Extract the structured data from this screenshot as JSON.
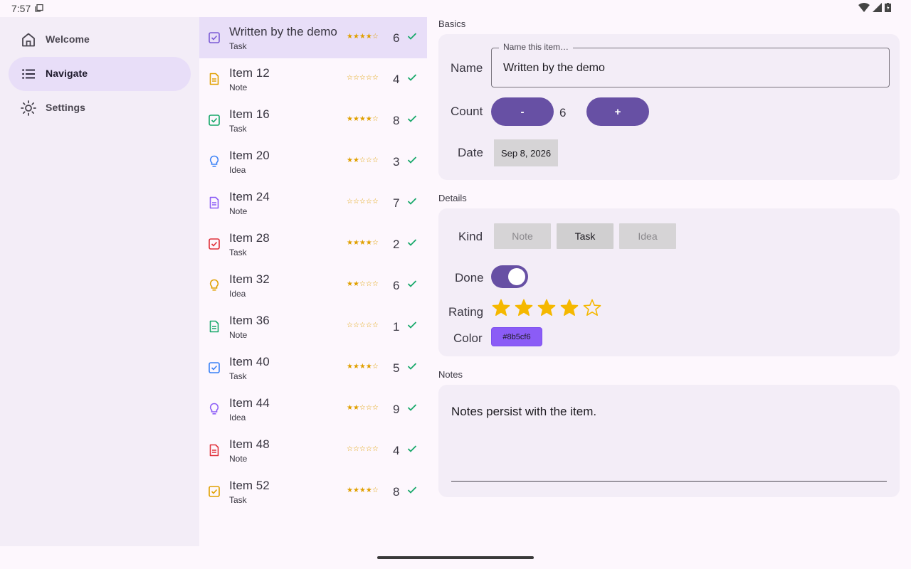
{
  "status_bar": {
    "time": "7:57"
  },
  "drawer": {
    "items": [
      {
        "label": "Welcome",
        "icon": "home-icon",
        "active": false
      },
      {
        "label": "Navigate",
        "icon": "list-icon",
        "active": true
      },
      {
        "label": "Settings",
        "icon": "brightness-icon",
        "active": false
      }
    ]
  },
  "list": {
    "rows": [
      {
        "title": "Written by the demo",
        "kind": "Task",
        "stars": "★★★★☆",
        "count": "6",
        "icon": "task-check-icon",
        "icon_color": "#7c5cd6",
        "selected": true
      },
      {
        "title": "Item 12",
        "kind": "Note",
        "stars": "☆☆☆☆☆",
        "count": "4",
        "icon": "note-doc-icon",
        "icon_color": "#e0a000",
        "selected": false
      },
      {
        "title": "Item 16",
        "kind": "Task",
        "stars": "★★★★☆",
        "count": "8",
        "icon": "task-check-icon",
        "icon_color": "#17a86a",
        "selected": false
      },
      {
        "title": "Item 20",
        "kind": "Idea",
        "stars": "★★☆☆☆",
        "count": "3",
        "icon": "lightbulb-icon",
        "icon_color": "#3b82f6",
        "selected": false
      },
      {
        "title": "Item 24",
        "kind": "Note",
        "stars": "☆☆☆☆☆",
        "count": "7",
        "icon": "note-doc-icon",
        "icon_color": "#8b5cf6",
        "selected": false
      },
      {
        "title": "Item 28",
        "kind": "Task",
        "stars": "★★★★☆",
        "count": "2",
        "icon": "task-check-icon",
        "icon_color": "#e0303a",
        "selected": false
      },
      {
        "title": "Item 32",
        "kind": "Idea",
        "stars": "★★☆☆☆",
        "count": "6",
        "icon": "lightbulb-icon",
        "icon_color": "#e0a000",
        "selected": false
      },
      {
        "title": "Item 36",
        "kind": "Note",
        "stars": "☆☆☆☆☆",
        "count": "1",
        "icon": "note-doc-icon",
        "icon_color": "#17a86a",
        "selected": false
      },
      {
        "title": "Item 40",
        "kind": "Task",
        "stars": "★★★★☆",
        "count": "5",
        "icon": "task-check-icon",
        "icon_color": "#3b82f6",
        "selected": false
      },
      {
        "title": "Item 44",
        "kind": "Idea",
        "stars": "★★☆☆☆",
        "count": "9",
        "icon": "lightbulb-icon",
        "icon_color": "#8b5cf6",
        "selected": false
      },
      {
        "title": "Item 48",
        "kind": "Note",
        "stars": "☆☆☆☆☆",
        "count": "4",
        "icon": "note-doc-icon",
        "icon_color": "#e0303a",
        "selected": false
      },
      {
        "title": "Item 52",
        "kind": "Task",
        "stars": "★★★★☆",
        "count": "8",
        "icon": "task-check-icon",
        "icon_color": "#e0a000",
        "selected": false
      }
    ],
    "check_color": "#17a86a"
  },
  "detail": {
    "basics": {
      "section_label": "Basics",
      "name_label": "Name",
      "name_legend": "Name this item…",
      "name_value": "Written by the demo",
      "count_label": "Count",
      "minus_label": "-",
      "plus_label": "+",
      "count_value": "6",
      "date_label": "Date",
      "date_value": "Sep 8, 2026"
    },
    "details": {
      "section_label": "Details",
      "kind_label": "Kind",
      "kinds": [
        "Note",
        "Task",
        "Idea"
      ],
      "kind_selected": "Task",
      "done_label": "Done",
      "done_value": true,
      "rating_label": "Rating",
      "rating_value": 4,
      "rating_max": 5,
      "color_label": "Color",
      "color_value": "#8b5cf6"
    },
    "notes": {
      "section_label": "Notes",
      "text": "Notes persist with the item."
    }
  },
  "colors": {
    "accent": "#6750a4",
    "selected_bg": "#e8def8",
    "star": "#f5b800"
  }
}
